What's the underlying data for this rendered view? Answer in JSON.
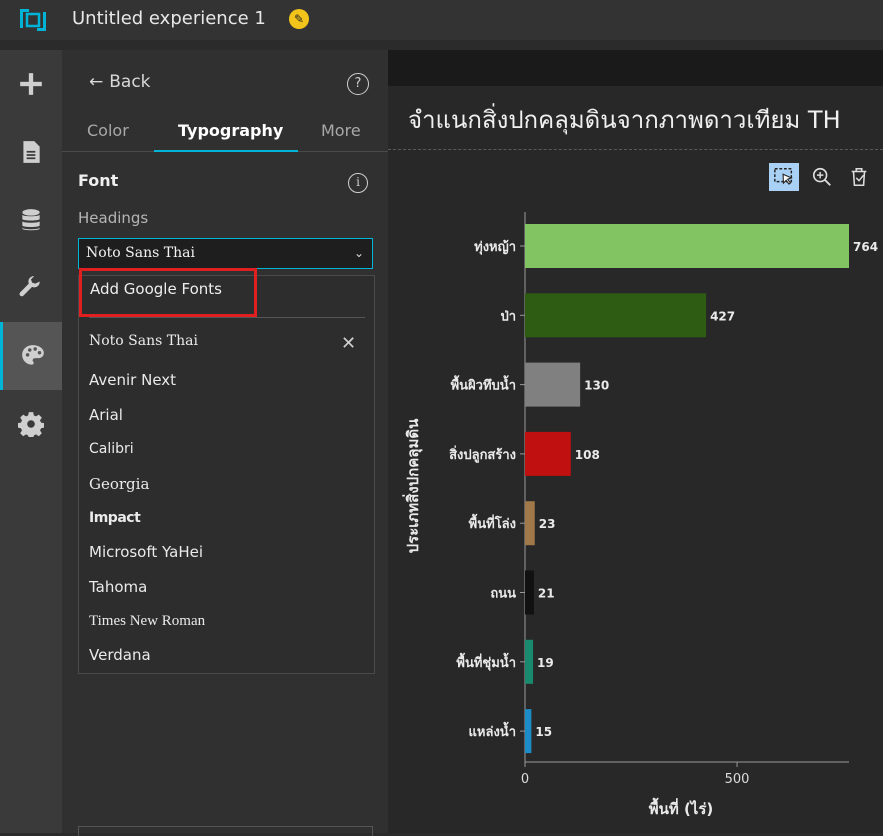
{
  "header": {
    "title": "Untitled experience 1"
  },
  "rail": {
    "items": [
      {
        "icon": "add-icon"
      },
      {
        "icon": "page-icon"
      },
      {
        "icon": "data-icon"
      },
      {
        "icon": "widget-tool-icon"
      },
      {
        "icon": "theme-palette-icon",
        "active": true
      },
      {
        "icon": "settings-gear-icon"
      }
    ]
  },
  "panel": {
    "back_label": "Back",
    "tabs": [
      {
        "label": "Color"
      },
      {
        "label": "Typography",
        "active": true
      },
      {
        "label": "More"
      }
    ],
    "section_title": "Font",
    "headings_label": "Headings",
    "selected_font": "Noto Sans Thai"
  },
  "dropdown": {
    "add_google_fonts": "Add Google Fonts",
    "fonts": [
      "Noto Sans Thai",
      "Avenir Next",
      "Arial",
      "Calibri",
      "Georgia",
      "Impact",
      "Microsoft YaHei",
      "Tahoma",
      "Times New Roman",
      "Verdana"
    ]
  },
  "colors": {
    "accent": "#00b4d8",
    "highlight": "#e02020"
  },
  "chart_panel": {
    "title": "จำแนกสิ่งปกคลุมดินจากภาพดาวเทียม TH"
  },
  "chart_data": {
    "type": "bar",
    "orientation": "horizontal",
    "categories": [
      "ทุ่งหญ้า",
      "ป่า",
      "พื้นผิวทึบน้ำ",
      "สิ่งปลูกสร้าง",
      "พื้นที่โล่ง",
      "ถนน",
      "พื้นที่ชุ่มน้ำ",
      "แหล่งน้ำ"
    ],
    "values": [
      764,
      427,
      130,
      108,
      23,
      21,
      19,
      15
    ],
    "bar_colors": [
      "#82c362",
      "#2d5c12",
      "#808080",
      "#c01010",
      "#a0784a",
      "#111111",
      "#1a8a6e",
      "#1c8cc8"
    ],
    "xlabel": "พื้นที่ (ไร่)",
    "ylabel": "ประเภทสิ่งปกคลุมดิน",
    "xticks": [
      0,
      500
    ],
    "xlim": [
      0,
      764
    ]
  }
}
